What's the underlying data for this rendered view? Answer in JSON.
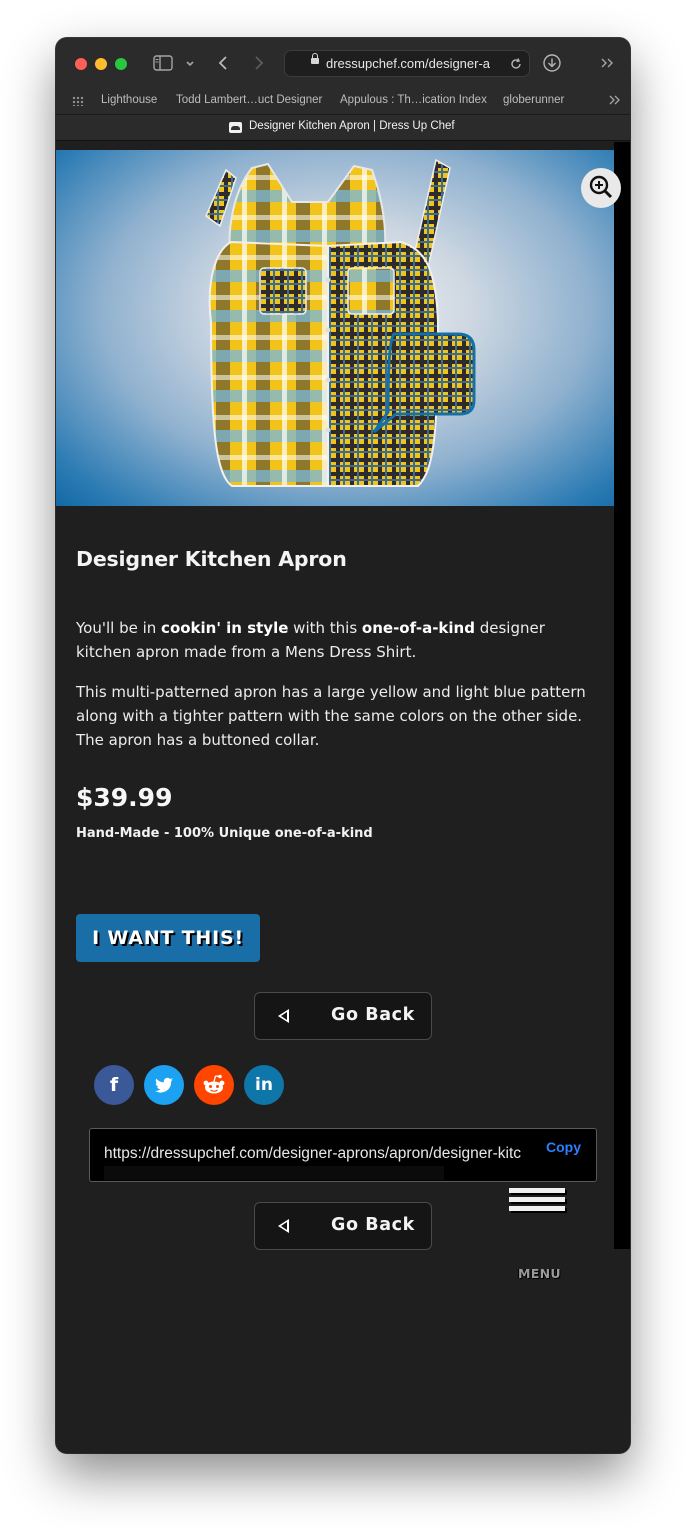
{
  "browser": {
    "url": "dressupchef.com/designer-a",
    "bookmarks": [
      "Lighthouse",
      "Todd Lambert…uct Designer",
      "Appulous : Th…ication Index",
      "globerunner"
    ],
    "tab_title": "Designer Kitchen Apron | Dress Up Chef",
    "colors": {
      "chrome": "#2b2b2c",
      "page_bg": "#1f1f20"
    }
  },
  "product": {
    "title": "Designer Kitchen Apron",
    "intro": {
      "p1": "You'll be in ",
      "b1": "cookin' in style",
      "p2": " with this ",
      "b2": "one-of-a-kind",
      "p3": " designer kitchen apron made from a Mens Dress Shirt."
    },
    "description": "This multi-patterned apron has a large yellow and light blue pattern along with a tighter pattern with the same colors on the other side. The apron has a buttoned collar.",
    "price": "$39.99",
    "tagline": "Hand-Made - 100% Unique one-of-a-kind",
    "cta_label": "I WANT THIS!",
    "accent_color": "#1a6ea8"
  },
  "nav": {
    "go_back_label": "Go Back",
    "menu_label": "MENU"
  },
  "share": {
    "networks": [
      {
        "name": "facebook",
        "icon": "facebook-icon",
        "color": "#3b5998",
        "glyph": "f"
      },
      {
        "name": "twitter",
        "icon": "twitter-icon",
        "color": "#1da1f2",
        "glyph": ""
      },
      {
        "name": "reddit",
        "icon": "reddit-icon",
        "color": "#ff4500",
        "glyph": ""
      },
      {
        "name": "linkedin",
        "icon": "linkedin-icon",
        "color": "#0e76a8",
        "glyph": "in"
      }
    ],
    "url": "https://dressupchef.com/designer-aprons/apron/designer-kitc",
    "copy_label": "Copy"
  }
}
